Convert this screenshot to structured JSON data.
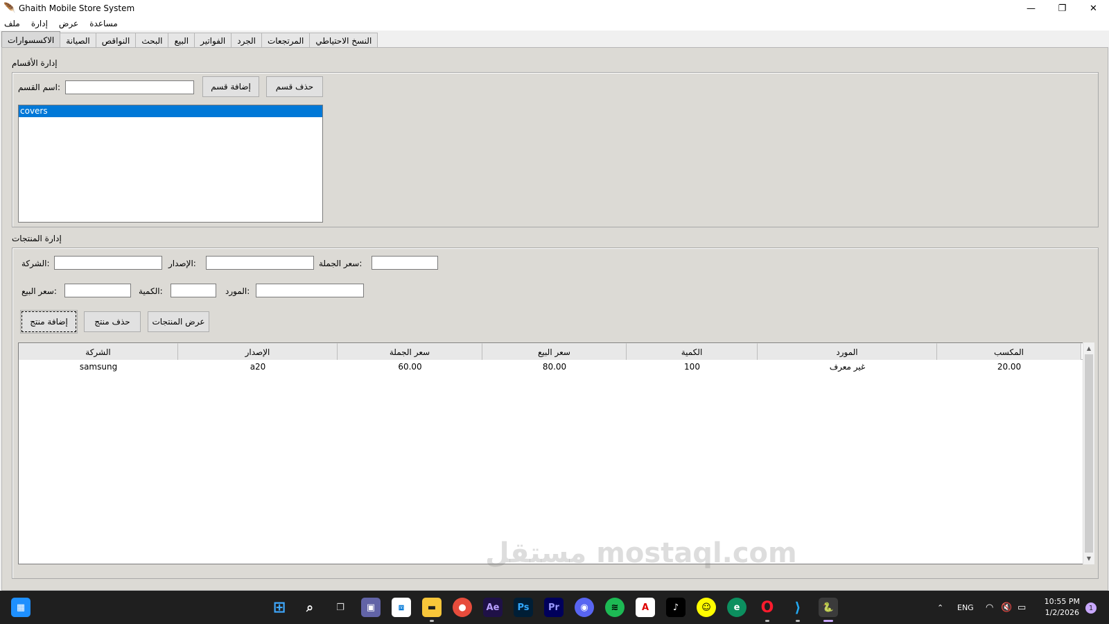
{
  "window": {
    "title": "Ghaith Mobile Store System",
    "minimize": "—",
    "restore": "❐",
    "close": "✕"
  },
  "menu": [
    "ملف",
    "إدارة",
    "عرض",
    "مساعدة"
  ],
  "tabs": [
    "الاكسسوارات",
    "الصيانة",
    "النواقص",
    "البحث",
    "البيع",
    "الفواتير",
    "الجرد",
    "المرتجعات",
    "النسخ الاحتياطي"
  ],
  "categories": {
    "group_label": "إدارة الأقسام",
    "name_label": "اسم القسم:",
    "name_value": "",
    "add_button": "إضافة قسم",
    "delete_button": "حذف قسم",
    "items": [
      "covers"
    ]
  },
  "products": {
    "group_label": "إدارة المنتجات",
    "company_label": "الشركة:",
    "version_label": "الإصدار:",
    "wholesale_label": "سعر الجملة:",
    "sale_price_label": "سعر البيع:",
    "quantity_label": "الكمية:",
    "supplier_label": "المورد:",
    "add_button": "إضافة منتج",
    "delete_button": "حذف منتج",
    "show_button": "عرض المنتجات",
    "columns": [
      "الشركة",
      "الإصدار",
      "سعر الجملة",
      "سعر البيع",
      "الكمية",
      "المورد",
      "المكسب"
    ],
    "rows": [
      [
        "samsung",
        "a20",
        "60.00",
        "80.00",
        "100",
        "غير معرف",
        "20.00"
      ]
    ]
  },
  "watermark": "مستقل mostaql.com",
  "taskbar": {
    "apps": [
      "windows-start",
      "search",
      "task-view",
      "teams",
      "store",
      "file-explorer",
      "chrome",
      "after-effects",
      "photoshop",
      "premiere",
      "discord",
      "spotify",
      "acrobat",
      "tiktok",
      "snapchat",
      "edge",
      "opera",
      "vscode",
      "python"
    ],
    "lang": "ENG",
    "time": "10:55 PM",
    "date": "1/2/2026",
    "notifications": "1"
  }
}
